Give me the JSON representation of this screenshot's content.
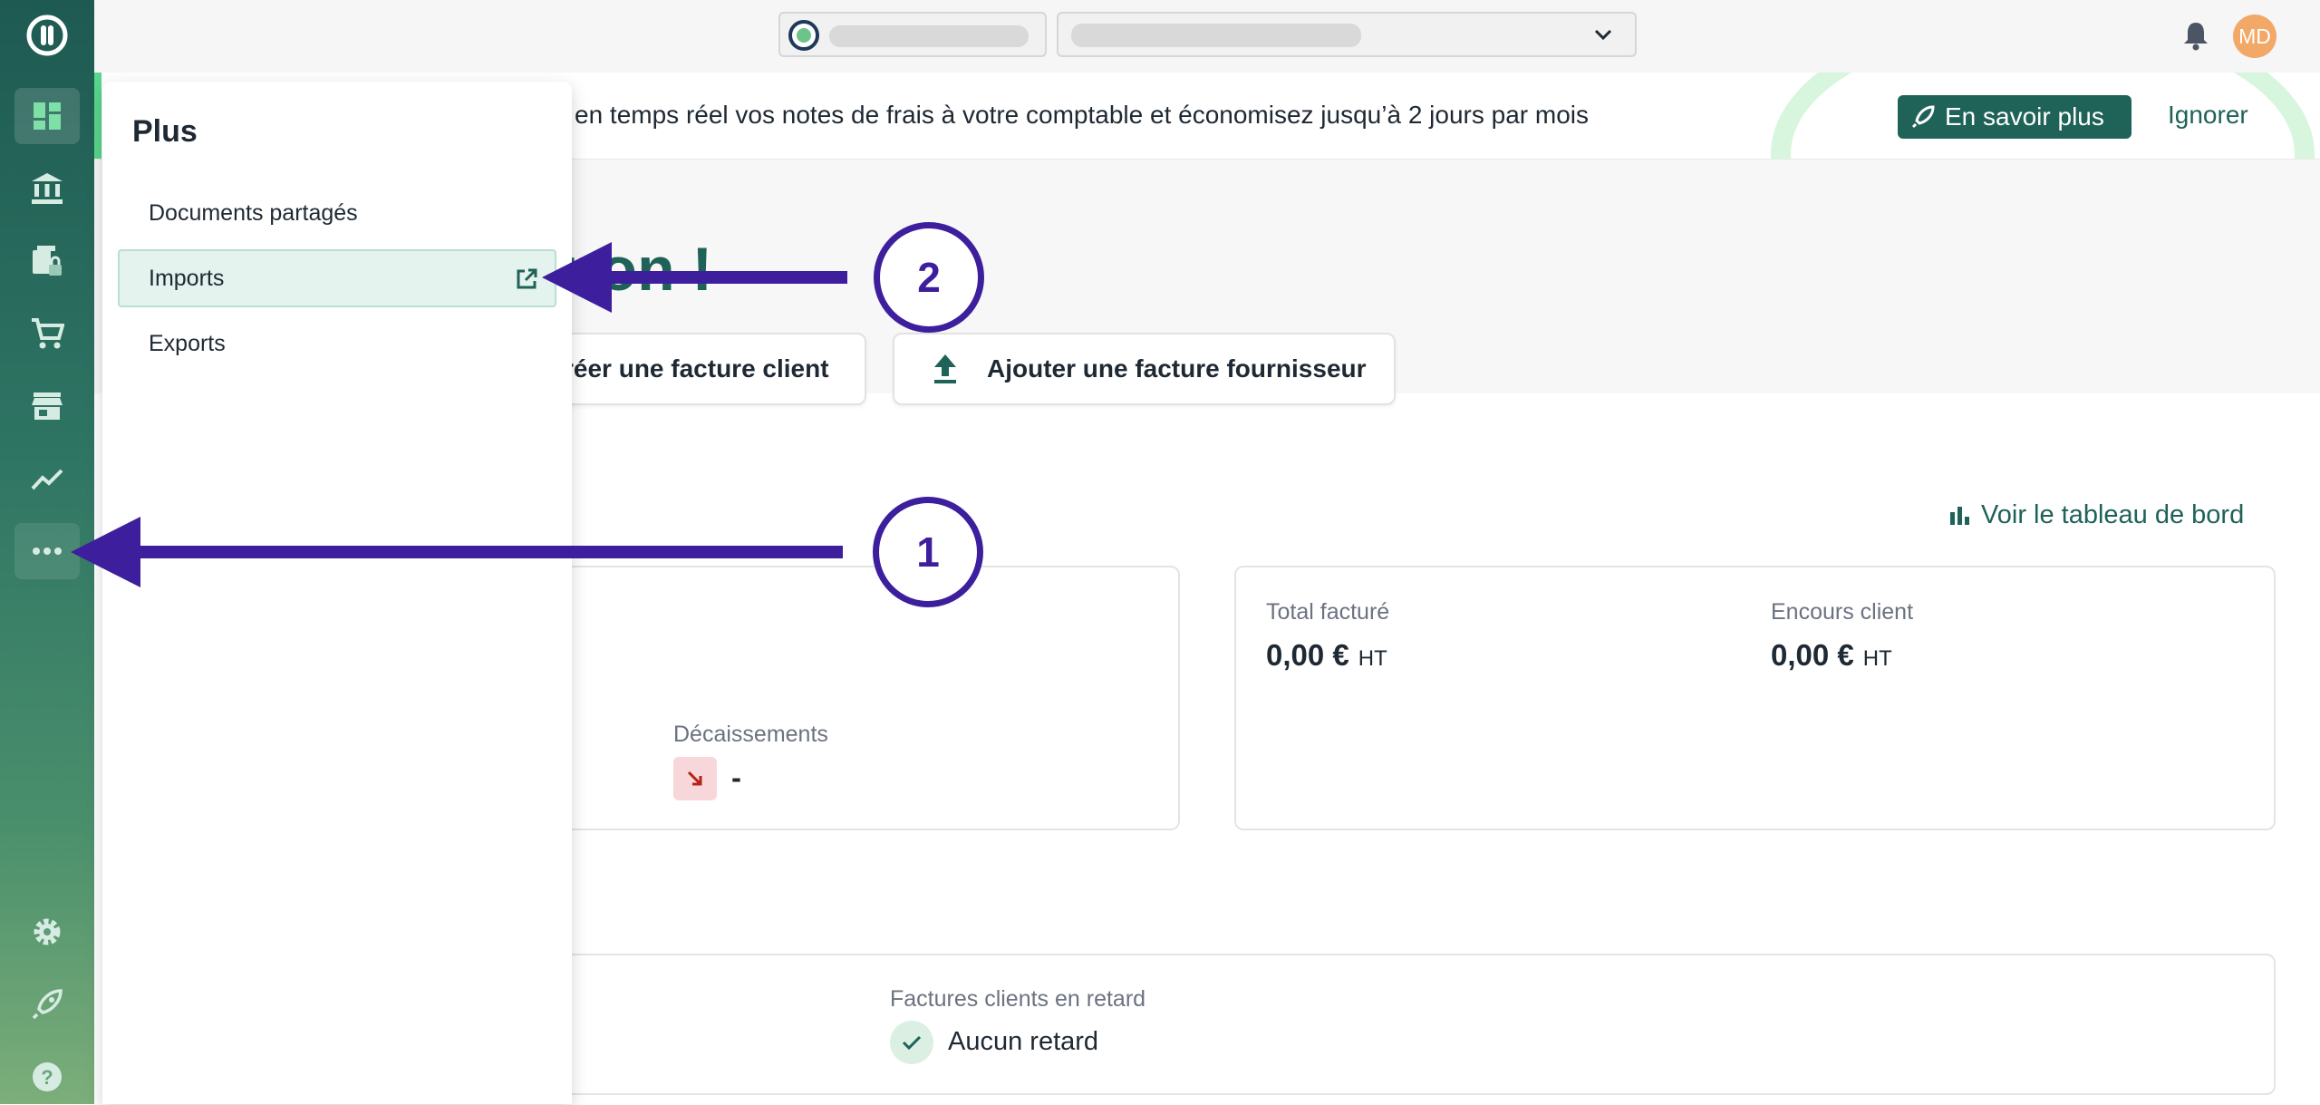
{
  "topbar": {
    "avatar_initials": "MD"
  },
  "banner": {
    "text": "en temps réel vos notes de frais à votre comptable et économisez jusqu’à 2 jours par mois",
    "learn_more": "En savoir plus",
    "ignore": "Ignorer"
  },
  "main": {
    "greeting_fragment": "non !",
    "create_invoice": "réer une facture client",
    "add_supplier_invoice": "Ajouter une facture fournisseur",
    "dashboard_link": "Voir le tableau de bord",
    "treasury_card": {
      "disbursements_label": "Décaissements",
      "disbursements_value": "-"
    },
    "billing_card": {
      "total_invoiced_label": "Total facturé",
      "total_invoiced_value": "0,00 €",
      "total_invoiced_unit": "HT",
      "outstanding_label": "Encours client",
      "outstanding_value": "0,00 €",
      "outstanding_unit": "HT"
    },
    "late_card": {
      "late_label": "Factures clients en retard",
      "late_value": "Aucun retard"
    }
  },
  "plus_menu": {
    "title": "Plus",
    "items": [
      {
        "label": "Documents partagés"
      },
      {
        "label": "Imports"
      },
      {
        "label": "Exports"
      }
    ]
  },
  "annotations": {
    "step1": "1",
    "step2": "2"
  },
  "colors": {
    "brand": "#1f6258",
    "annotation": "#3d1f9e",
    "sidebar_top": "#1e5a52",
    "sidebar_bottom": "#7cae7a",
    "highlight": "#e4f3ee"
  },
  "icons": {
    "sidebar": [
      "logo-icon",
      "dashboard-icon",
      "bank-icon",
      "documents-lock-icon",
      "cart-icon",
      "store-icon",
      "chart-line-icon",
      "more-dots-icon",
      "gear-icon",
      "rocket-icon",
      "help-icon"
    ]
  }
}
